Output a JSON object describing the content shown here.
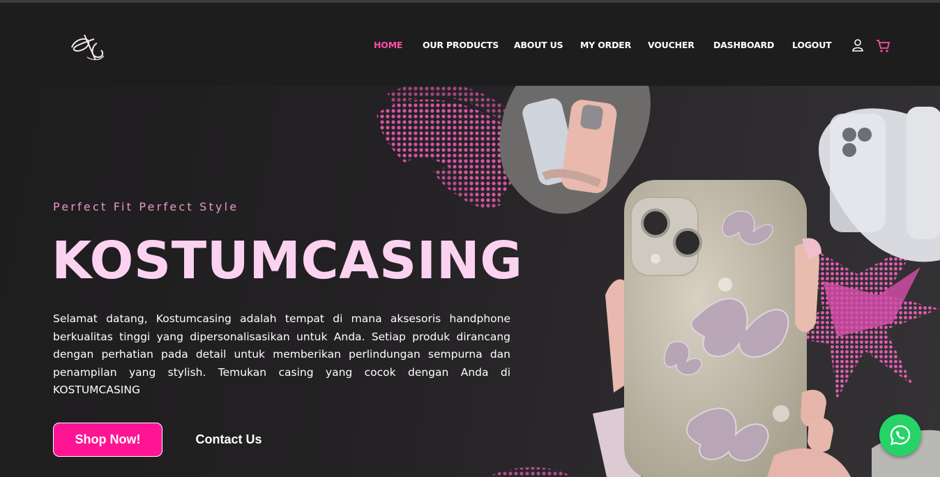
{
  "colors": {
    "accent": "#ff4fa6",
    "title": "#fbd3f0",
    "button": "#ff1493",
    "whatsapp": "#25d366"
  },
  "nav": {
    "items": [
      {
        "label": "HOME",
        "active": true
      },
      {
        "label": "OUR PRODUCTS",
        "active": false
      },
      {
        "label": "ABOUT US",
        "active": false
      },
      {
        "label": "MY ORDER",
        "active": false
      },
      {
        "label": "VOUCHER",
        "active": false
      },
      {
        "label": "DASHBOARD",
        "active": false
      },
      {
        "label": "LOGOUT",
        "active": false
      }
    ],
    "icons": [
      "user-icon",
      "cart-icon"
    ]
  },
  "hero": {
    "tagline": "Perfect Fit Perfect Style",
    "title": "KOSTUMCASING",
    "description": "Selamat datang, Kostumcasing adalah tempat di mana aksesoris handphone berkualitas tinggi yang dipersonalisasikan untuk Anda. Setiap produk dirancang dengan perhatian pada detail untuk memberikan perlindungan sempurna dan penampilan yang stylish. Temukan casing yang cocok dengan Anda di KOSTUMCASING",
    "shop_button": "Shop Now!",
    "contact_button": "Contact Us"
  },
  "floating": {
    "icon": "whatsapp-icon"
  }
}
